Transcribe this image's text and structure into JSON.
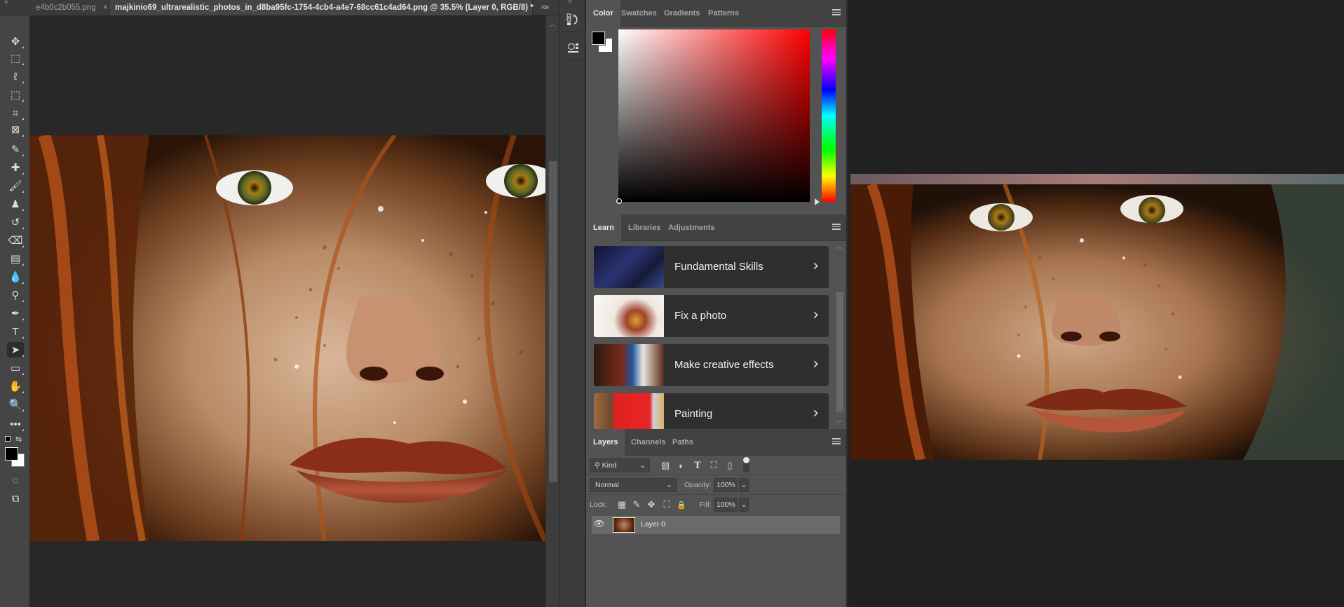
{
  "document_tabs": [
    {
      "label": "e4b0c2b055.png",
      "active": false,
      "close": "×"
    },
    {
      "label": "majkinio69_ultrarealistic_photos_in_d8ba95fc-1754-4cb4-a4e7-68cc61c4ad64.png @ 35.5% (Layer 0, RGB/8) *",
      "active": true,
      "close": "×"
    }
  ],
  "tabs_overflow": "»",
  "collapse_glyph": "«",
  "tools": [
    {
      "name": "move-tool",
      "glyph": "✥"
    },
    {
      "name": "marquee-tool",
      "glyph": "⬚"
    },
    {
      "name": "lasso-tool",
      "glyph": "ℓ"
    },
    {
      "name": "object-selection-tool",
      "glyph": "⬚"
    },
    {
      "name": "crop-tool",
      "glyph": "⌗"
    },
    {
      "name": "frame-tool",
      "glyph": "⊠"
    },
    {
      "name": "eyedropper-tool",
      "glyph": "✎"
    },
    {
      "name": "healing-brush-tool",
      "glyph": "✚"
    },
    {
      "name": "brush-tool",
      "glyph": "🖌"
    },
    {
      "name": "clone-stamp-tool",
      "glyph": "♟"
    },
    {
      "name": "history-brush-tool",
      "glyph": "↺"
    },
    {
      "name": "eraser-tool",
      "glyph": "⌫"
    },
    {
      "name": "gradient-tool",
      "glyph": "▤"
    },
    {
      "name": "blur-tool",
      "glyph": "💧"
    },
    {
      "name": "dodge-tool",
      "glyph": "⚲"
    },
    {
      "name": "pen-tool",
      "glyph": "✒"
    },
    {
      "name": "type-tool",
      "glyph": "T"
    },
    {
      "name": "path-selection-tool",
      "glyph": "➤",
      "selected": true
    },
    {
      "name": "rectangle-tool",
      "glyph": "▭"
    },
    {
      "name": "hand-tool",
      "glyph": "✋"
    },
    {
      "name": "zoom-tool",
      "glyph": "🔍"
    },
    {
      "name": "edit-toolbar",
      "glyph": "•••"
    }
  ],
  "swap_glyph": "⇆",
  "quick_mask_glyph": "◌",
  "screen_mode_glyph": "⧉",
  "foreground_color": "#000000",
  "background_color": "#ffffff",
  "color_panel": {
    "tabs": [
      "Color",
      "Swatches",
      "Gradients",
      "Patterns"
    ],
    "active_tab": "Color",
    "hue": "#ff0000"
  },
  "learn_panel": {
    "tabs": [
      "Learn",
      "Libraries",
      "Adjustments"
    ],
    "active_tab": "Learn",
    "cards": [
      {
        "label": "Fundamental Skills",
        "chevron": "›"
      },
      {
        "label": "Fix a photo",
        "chevron": "›"
      },
      {
        "label": "Make creative effects",
        "chevron": "›"
      },
      {
        "label": "Painting",
        "chevron": "›"
      }
    ],
    "scroll_up": "︿",
    "scroll_down": "﹀"
  },
  "layers_panel": {
    "tabs": [
      "Layers",
      "Channels",
      "Paths"
    ],
    "active_tab": "Layers",
    "filter_kind": "Kind",
    "blend_mode": "Normal",
    "opacity_label": "Opacity:",
    "opacity_value": "100%",
    "lock_label": "Lock:",
    "fill_label": "Fill:",
    "fill_value": "100%",
    "layers": [
      {
        "name": "Layer 0",
        "visible": true
      }
    ],
    "filter_icons": {
      "pixel": "▨",
      "adjustment": "◐",
      "type": "T",
      "shape": "⛶",
      "smart": "▯"
    },
    "lock_icons": {
      "transparent": "▦",
      "image": "✎",
      "position": "✥",
      "artboard": "⛶",
      "all": "🔒"
    },
    "dropdown_glyph": "⌄",
    "eye_glyph": "👁"
  }
}
